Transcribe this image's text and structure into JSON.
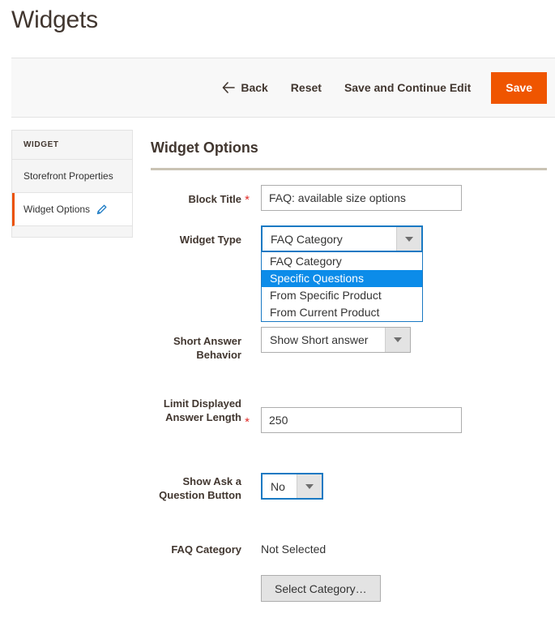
{
  "page": {
    "title": "Widgets"
  },
  "toolbar": {
    "back_label": "Back",
    "back_icon": "arrow-left-icon",
    "reset_label": "Reset",
    "save_continue_label": "Save and Continue Edit",
    "save_label": "Save",
    "save_color": "#ef5500"
  },
  "sidebar": {
    "heading": "WIDGET",
    "items": [
      {
        "label": "Storefront Properties",
        "active": false
      },
      {
        "label": "Widget Options",
        "active": true,
        "icon": "pencil-icon"
      }
    ],
    "active_accent": "#eb5202"
  },
  "main": {
    "section_title": "Widget Options",
    "fields": {
      "block_title": {
        "label": "Block Title",
        "required": "*",
        "value": "FAQ: available size options"
      },
      "widget_type": {
        "label": "Widget Type",
        "required": "",
        "value": "FAQ Category",
        "expanded": true,
        "options": [
          {
            "label": "FAQ Category",
            "highlighted": false
          },
          {
            "label": "Specific Questions",
            "highlighted": true
          },
          {
            "label": "From Specific Product",
            "highlighted": false
          },
          {
            "label": "From Current Product",
            "highlighted": false
          }
        ],
        "highlight_color": "#0c8ce9"
      },
      "short_answer_behavior": {
        "label": "Short Answer Behavior",
        "required": "",
        "value": "Show Short answer"
      },
      "limit_length": {
        "label": "Limit Displayed Answer Length",
        "required": "*",
        "value": "250"
      },
      "show_ask_button": {
        "label": "Show Ask a Question Button",
        "required": "",
        "value": "No"
      },
      "faq_category": {
        "label": "FAQ Category",
        "required": "",
        "value": "Not Selected"
      }
    },
    "select_category_button": "Select Category…"
  }
}
